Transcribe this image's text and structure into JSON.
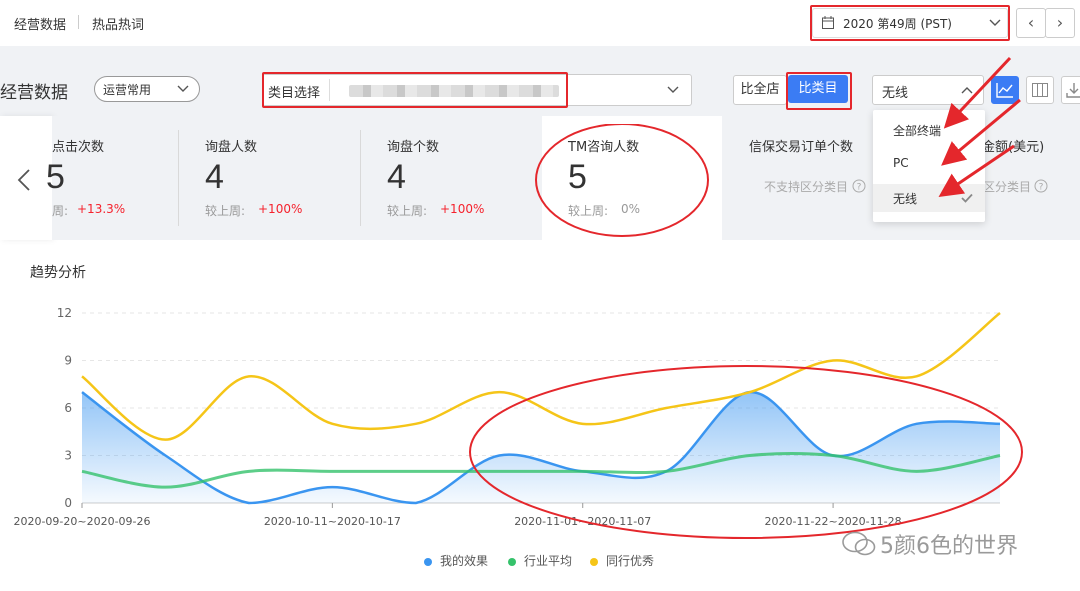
{
  "topnav": {
    "tab1": "经营数据",
    "tab2": "热品热词"
  },
  "date_select": {
    "value": "2020 第49周 (PST)"
  },
  "page_title": "经营数据",
  "preset": {
    "value": "运营常用"
  },
  "category": {
    "label": "类目选择"
  },
  "compare": {
    "shop": "比全店",
    "category": "比类目"
  },
  "terminal": {
    "value": "无线",
    "options": [
      "全部终端",
      "PC",
      "无线"
    ]
  },
  "metrics": [
    {
      "label": "点击次数",
      "value": "5",
      "compare": "周:",
      "change": "+13.3%"
    },
    {
      "label": "询盘人数",
      "value": "4",
      "compare": "较上周:",
      "change": "+100%"
    },
    {
      "label": "询盘个数",
      "value": "4",
      "compare": "较上周:",
      "change": "+100%"
    },
    {
      "label": "TM咨询人数",
      "value": "5",
      "compare": "较上周:",
      "change": "0%"
    },
    {
      "label": "信保交易订单个数",
      "note": "不支持区分类目"
    },
    {
      "label": "金额(美元)",
      "note": "区分类目"
    }
  ],
  "trend_title": "趋势分析",
  "legend": {
    "mine": "我的效果",
    "avg": "行业平均",
    "top": "同行优秀"
  },
  "watermark": "5颜6色的世界",
  "colors": {
    "mine": "#3a95f0",
    "avg": "#35c26b",
    "top": "#f5c518",
    "accent": "#3b7cf4",
    "highlight": "#e4272c"
  },
  "chart_data": {
    "type": "area",
    "x_tick_labels": [
      "2020-09-20~2020-09-26",
      "2020-10-11~2020-10-17",
      "2020-11-01~2020-11-07",
      "2020-11-22~2020-11-28"
    ],
    "x_tick_positions": [
      0,
      3,
      6,
      9
    ],
    "ylim": [
      0,
      12
    ],
    "y_ticks": [
      0,
      3,
      6,
      9,
      12
    ],
    "grid": true,
    "legend_position": "bottom",
    "series": [
      {
        "name": "我的效果",
        "key": "mine",
        "values": [
          7,
          3,
          0,
          1,
          0,
          3,
          2,
          2,
          7,
          3,
          5,
          5
        ]
      },
      {
        "name": "行业平均",
        "key": "avg",
        "values": [
          2,
          1,
          2,
          2,
          2,
          2,
          2,
          2,
          3,
          3,
          2,
          3
        ]
      },
      {
        "name": "同行优秀",
        "key": "top",
        "values": [
          8,
          4,
          8,
          5,
          5,
          7,
          5,
          6,
          7,
          9,
          8,
          12
        ]
      }
    ]
  }
}
